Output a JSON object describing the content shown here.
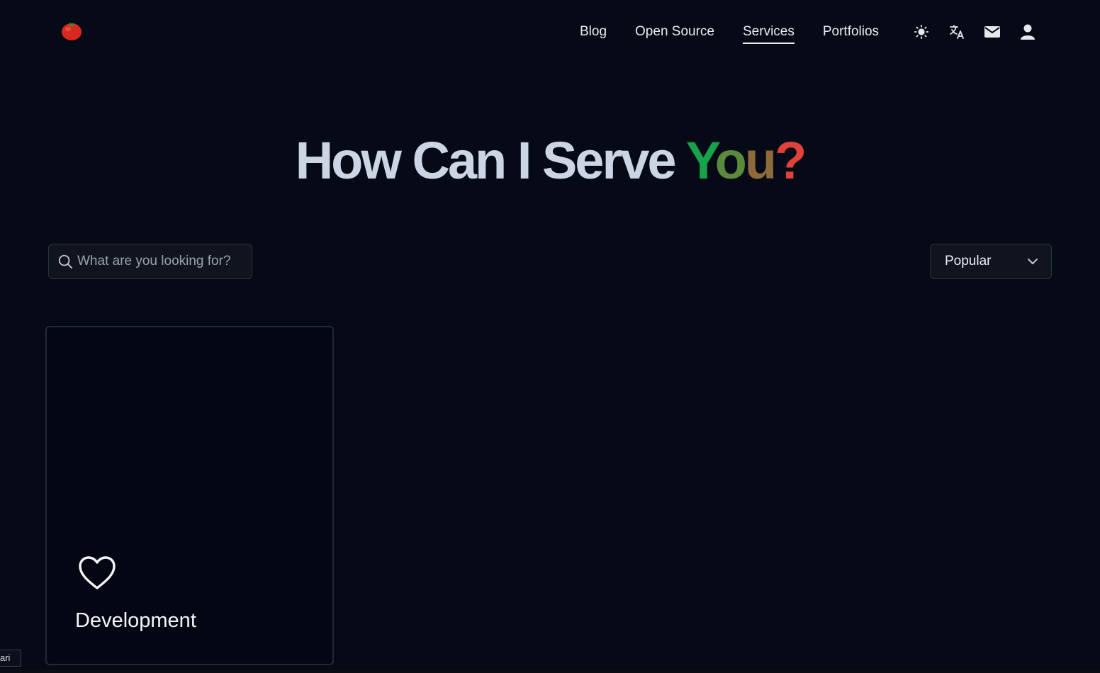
{
  "header": {
    "logo_icon": "tomato-icon",
    "nav": [
      {
        "label": "Blog",
        "active": false
      },
      {
        "label": "Open Source",
        "active": false
      },
      {
        "label": "Services",
        "active": true
      },
      {
        "label": "Portfolios",
        "active": false
      }
    ],
    "icons": [
      "sun-icon",
      "translate-icon",
      "mail-icon",
      "user-icon"
    ]
  },
  "hero": {
    "title_part": "How Can I Serve ",
    "you_y": "Y",
    "you_o": "o",
    "you_u": "u",
    "question": "?"
  },
  "search": {
    "placeholder": "What are you looking for?",
    "value": ""
  },
  "sort": {
    "selected": "Popular"
  },
  "cards": [
    {
      "title": "Development",
      "icon": "heart-icon"
    }
  ],
  "corner_tooltip": "ari",
  "colors": {
    "background": "#060a17",
    "hero_text": "#cbd5e3",
    "accent_green": "#16a34a",
    "accent_red": "#e0413b"
  }
}
